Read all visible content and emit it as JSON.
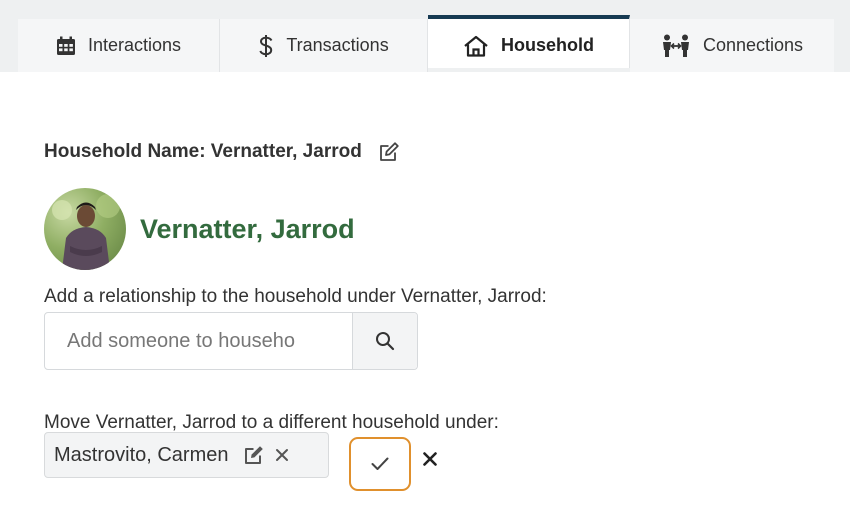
{
  "tabs": [
    {
      "label": "Interactions",
      "icon": "calendar-icon",
      "active": false
    },
    {
      "label": "Transactions",
      "icon": "dollar-icon",
      "active": false
    },
    {
      "label": "Household",
      "icon": "home-icon",
      "active": true
    },
    {
      "label": "Connections",
      "icon": "people-connection-icon",
      "active": false
    }
  ],
  "household": {
    "name_text": "Household Name: Vernatter, Jarrod"
  },
  "person": {
    "name": "Vernatter, Jarrod"
  },
  "add_relationship": {
    "label": "Add a relationship to the household under Vernatter, Jarrod:",
    "placeholder": "Add someone to househo"
  },
  "move": {
    "label": "Move Vernatter, Jarrod to a different household under:",
    "selected": "Mastrovito, Carmen"
  },
  "colors": {
    "active_tab_border": "#163a52",
    "person_name": "#336b3e",
    "confirm_border": "#e0902d"
  }
}
